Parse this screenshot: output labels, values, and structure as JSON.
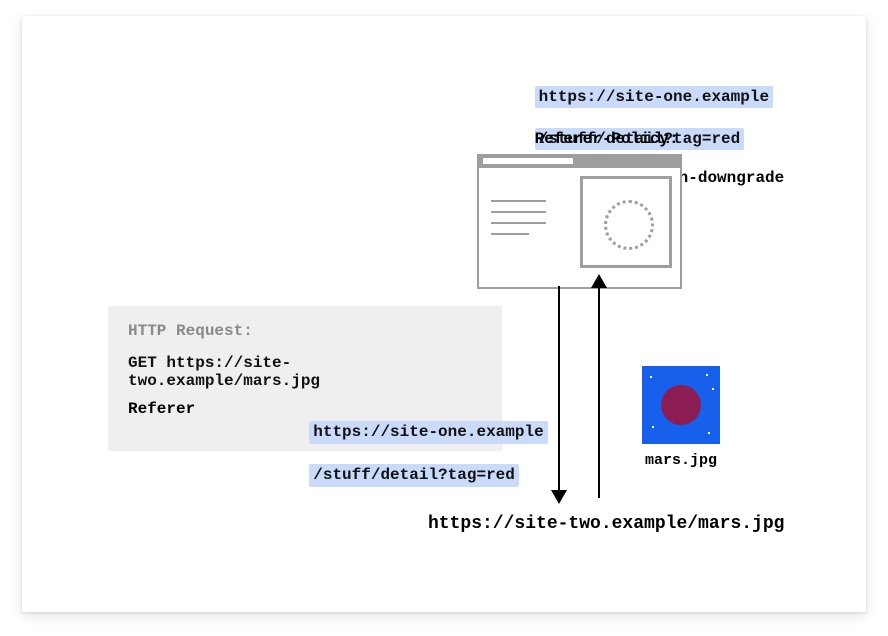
{
  "origin": {
    "url_line1": "https://site-one.example",
    "url_line2": "/stuff/detail?tag=red",
    "policy_label": "Referer-Policy:",
    "policy_value": "no-referrer-when-downgrade"
  },
  "request": {
    "heading": "HTTP Request:",
    "line": "GET https://site-two.example/mars.jpg",
    "referer_label": "Referer",
    "referer_line1": "https://site-one.example",
    "referer_line2": "/stuff/detail?tag=red"
  },
  "resource": {
    "filename": "mars.jpg",
    "url": "https://site-two.example/mars.jpg"
  },
  "colors": {
    "highlight": "#c9dafb",
    "panel": "#efefef",
    "mars_bg": "#1760ec",
    "mars_planet": "#8c1d52"
  }
}
